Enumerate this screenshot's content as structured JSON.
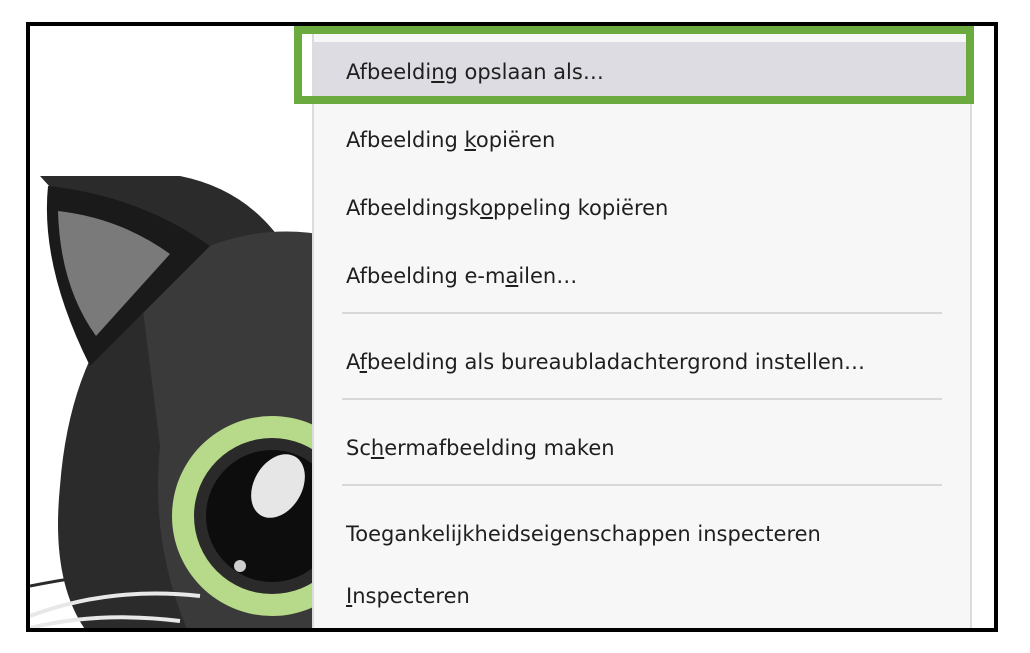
{
  "menu": {
    "items": [
      {
        "pre": "Afbeeldi",
        "key": "n",
        "post": "g opslaan als…",
        "highlighted": true
      },
      {
        "pre": "Afbeelding ",
        "key": "k",
        "post": "opiëren"
      },
      {
        "pre": "Afbeeldingsk",
        "key": "o",
        "post": "ppeling kopiëren"
      },
      {
        "pre": "Afbeelding e-m",
        "key": "a",
        "post": "ilen…"
      },
      {
        "pre": "A",
        "key": "f",
        "post": "beelding als bureaubladachtergrond instellen…"
      },
      {
        "pre": "Sc",
        "key": "h",
        "post": "ermafbeelding maken"
      },
      {
        "pre": "Toegankelijkheidseigenschappen inspecteren",
        "key": "",
        "post": ""
      },
      {
        "pre": "",
        "key": "I",
        "post": "nspecteren"
      }
    ]
  },
  "colors": {
    "highlight_border": "#6aaa3f",
    "highlight_bg": "#dcdce2",
    "menu_bg": "#f7f7f7",
    "cat_fur": "#2a2a2a",
    "cat_eye": "#b7d98a"
  },
  "icons": [
    "cat-illustration"
  ]
}
